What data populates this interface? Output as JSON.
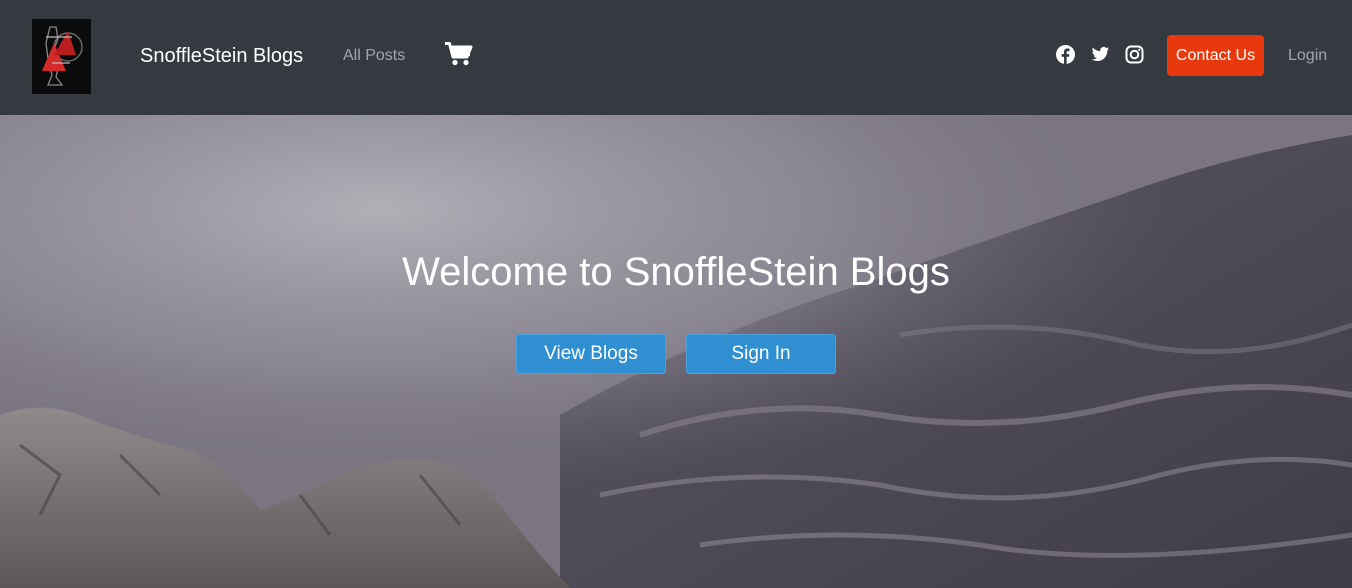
{
  "navbar": {
    "brand": "SnoffleStein Blogs",
    "all_posts": "All Posts",
    "contact": "Contact Us",
    "login": "Login",
    "icons": [
      "logo-image",
      "shopping-cart-icon",
      "facebook-icon",
      "twitter-icon",
      "instagram-icon"
    ]
  },
  "hero": {
    "title": "Welcome to SnoffleStein Blogs",
    "view_blogs": "View Blogs",
    "sign_in": "Sign In"
  },
  "colors": {
    "navbar_bg": "#343a40",
    "contact_btn": "#e8380d",
    "hero_btn": "#2f8fd0"
  }
}
